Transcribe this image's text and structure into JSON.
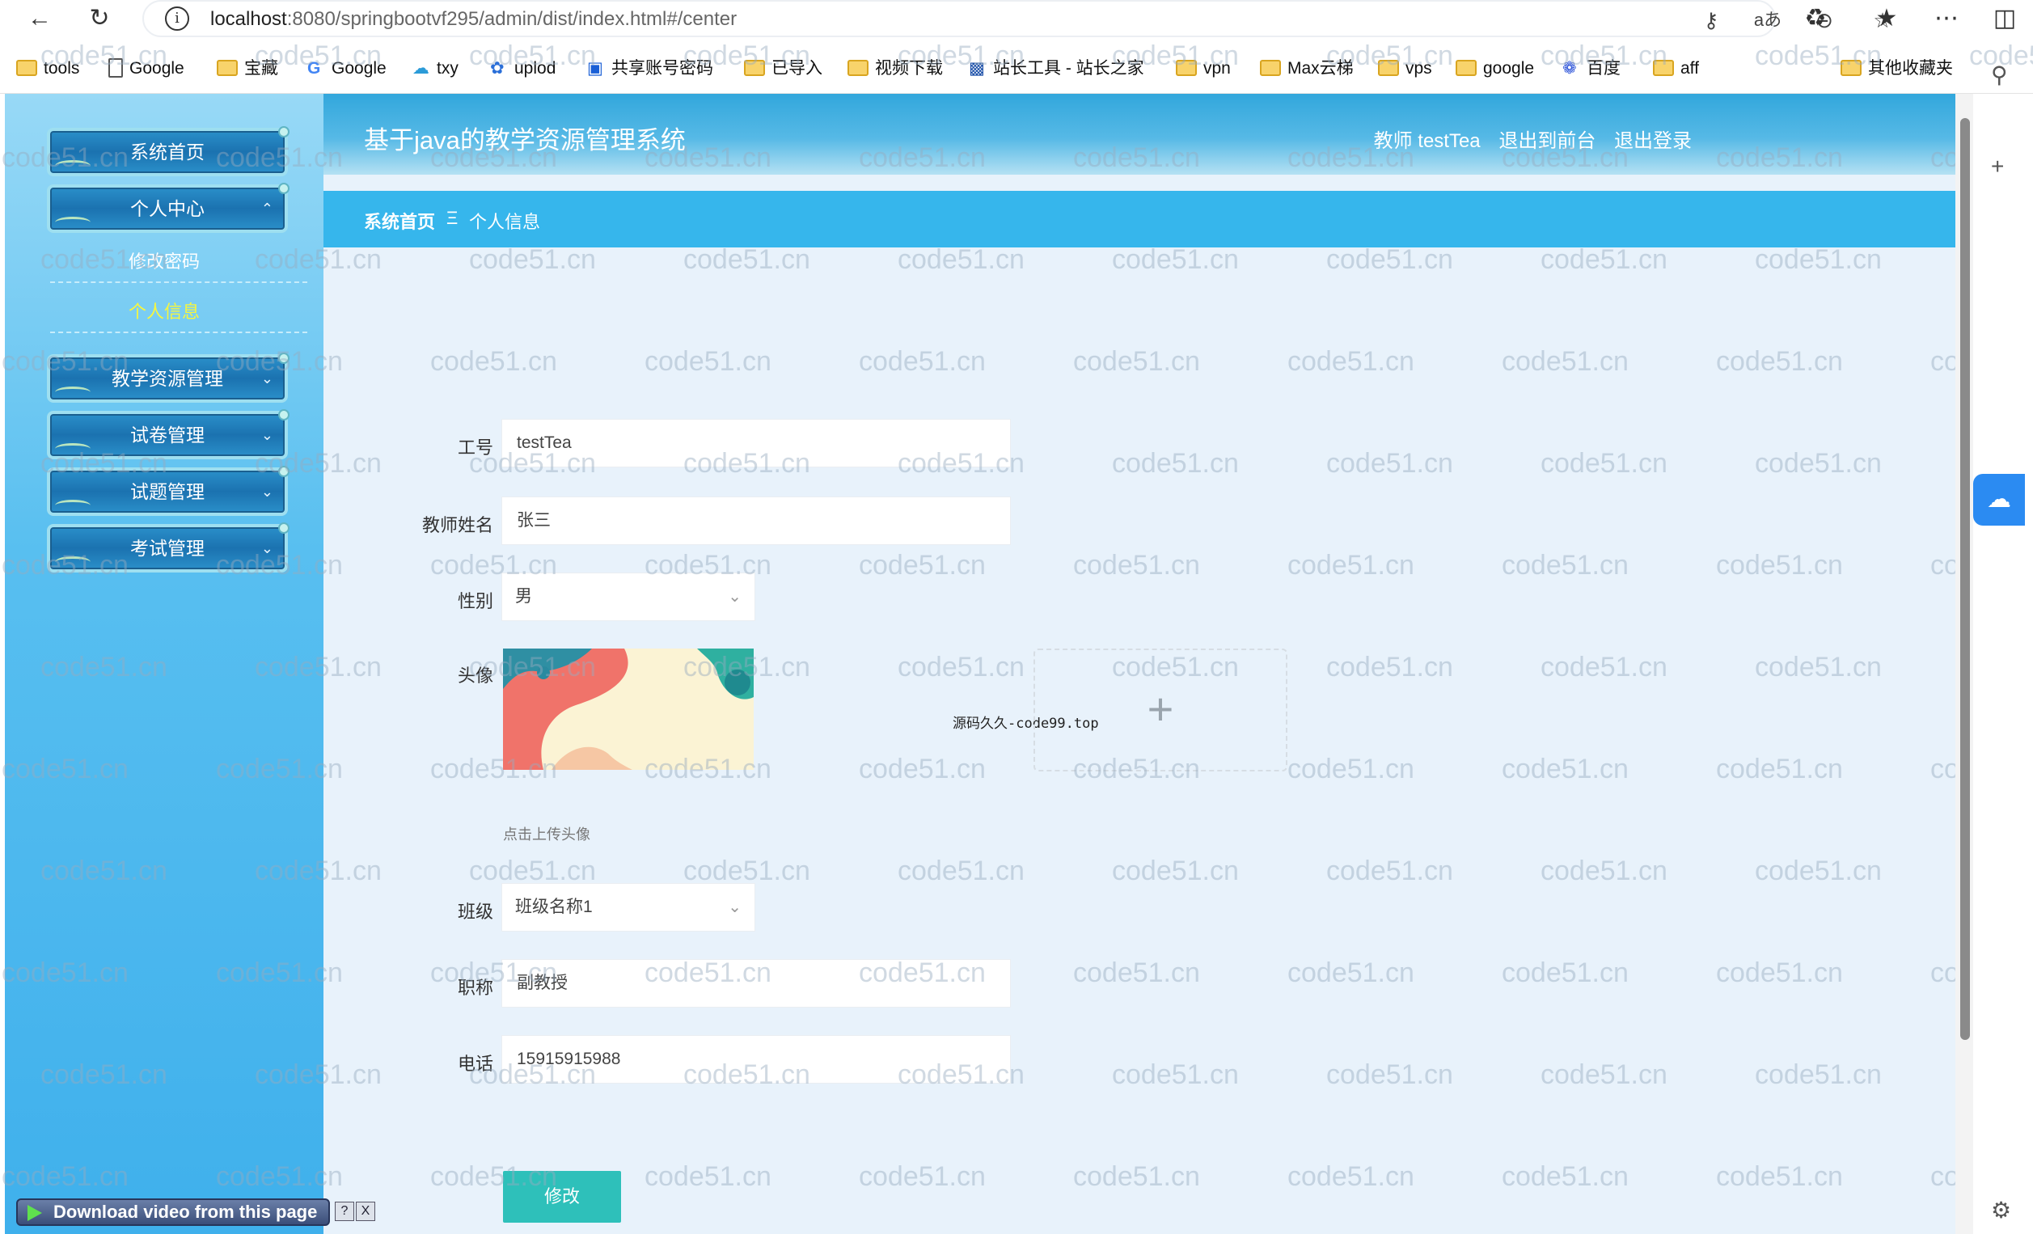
{
  "browser": {
    "url_host": "localhost",
    "url_rest": ":8080/springbootvf295/admin/dist/index.html#/center",
    "bookmarks": [
      "tools",
      "Google",
      "宝藏",
      "Google",
      "txy",
      "uplod",
      "共享账号密码",
      "已导入",
      "视频下载",
      "站长工具 - 站长之家",
      "vpn",
      "Max云梯",
      "vps",
      "google",
      "百度",
      "aff",
      "其他收藏夹"
    ]
  },
  "sidebar": {
    "home": "系统首页",
    "personal_center": "个人中心",
    "change_password": "修改密码",
    "personal_info": "个人信息",
    "teaching_resources": "教学资源管理",
    "paper_mgmt": "试卷管理",
    "question_mgmt": "试题管理",
    "exam_mgmt": "考试管理"
  },
  "header": {
    "title": "基于java的教学资源管理系统",
    "user": "教师 testTea",
    "to_front": "退出到前台",
    "logout": "退出登录"
  },
  "breadcrumb": {
    "home": "系统首页",
    "sep": "Ξ",
    "current": "个人信息"
  },
  "form": {
    "id_label": "工号",
    "id_value": "testTea",
    "name_label": "教师姓名",
    "name_value": "张三",
    "gender_label": "性别",
    "gender_value": "男",
    "avatar_label": "头像",
    "avatar_hint": "点击上传头像",
    "class_label": "班级",
    "class_value": "班级名称1",
    "title_label": "职称",
    "title_value": "副教授",
    "phone_label": "电话",
    "phone_value": "15915915988",
    "submit_label": "修改"
  },
  "overlay": {
    "source_text": "源码久久-code99.top",
    "watermark": "code51.cn",
    "download_label": "Download video from this page",
    "help": "?",
    "close": "X"
  }
}
